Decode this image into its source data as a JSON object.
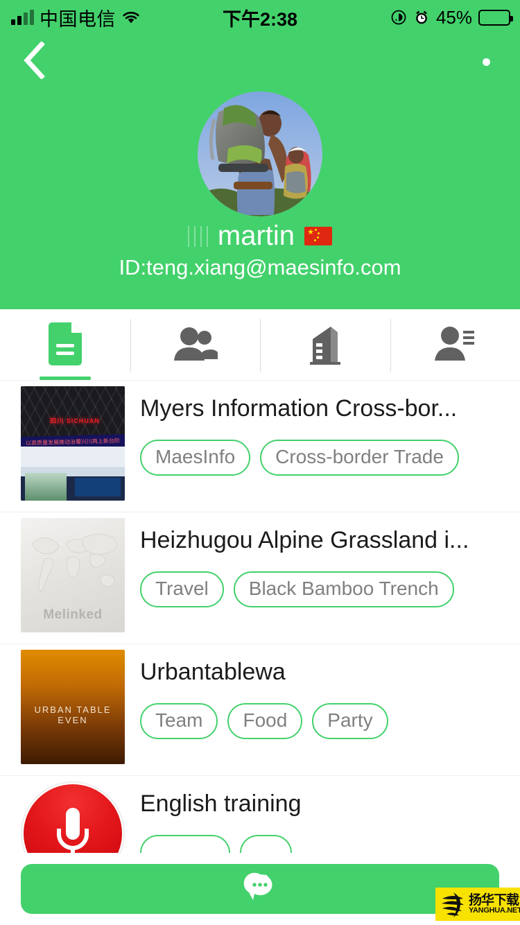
{
  "status_bar": {
    "carrier": "中国电信",
    "time": "下午2:38",
    "battery_percent": "45%",
    "icons": [
      "signal-icon",
      "wifi-icon",
      "rotation-lock-icon",
      "alarm-icon",
      "battery-icon"
    ]
  },
  "nav": {
    "back_icon": "back-chevron-icon",
    "more_icon": "more-options-icon"
  },
  "profile": {
    "avatar_alt": "hikers-with-backpacks-photo",
    "name": "martin",
    "name_prefix_glyphs": "||||",
    "flag": "cn-flag",
    "id_label": "ID:teng.xiang@maesinfo.com"
  },
  "tabs": [
    {
      "name": "tab-posts",
      "icon": "document-icon",
      "active": true
    },
    {
      "name": "tab-groups",
      "icon": "people-icon",
      "active": false
    },
    {
      "name": "tab-company",
      "icon": "building-icon",
      "active": false
    },
    {
      "name": "tab-contact",
      "icon": "person-details-icon",
      "active": false
    }
  ],
  "list": [
    {
      "thumb": "exhibition-hall-photo",
      "thumb_sign": "四川 SICHUAN",
      "thumb_banner": "以高质量发展推动治蜀兴川再上新台阶",
      "title": "Myers Information Cross-bor...",
      "tags": [
        "MaesInfo",
        "Cross-border Trade"
      ]
    },
    {
      "thumb": "world-map-placeholder",
      "thumb_watermark": "Melinked",
      "title": "Heizhugou Alpine Grassland i...",
      "tags": [
        "Travel",
        "Black Bamboo Trench"
      ]
    },
    {
      "thumb": "urban-table-event-poster",
      "thumb_caption": "URBAN TABLE EVEN",
      "title": "Urbantablewa",
      "tags": [
        "Team",
        "Food",
        "Party"
      ]
    },
    {
      "thumb": "microphone-app-icon",
      "title": "English training",
      "tags": []
    }
  ],
  "chat_button": {
    "icon": "chat-bubble-icon"
  },
  "watermark": {
    "cn": "扬华下载",
    "en": "YANGHUA.NET"
  },
  "colors": {
    "brand_green": "#43d16c",
    "tag_border": "#43d16c",
    "tag_text": "#808080",
    "title_text": "#1b1b1b"
  }
}
